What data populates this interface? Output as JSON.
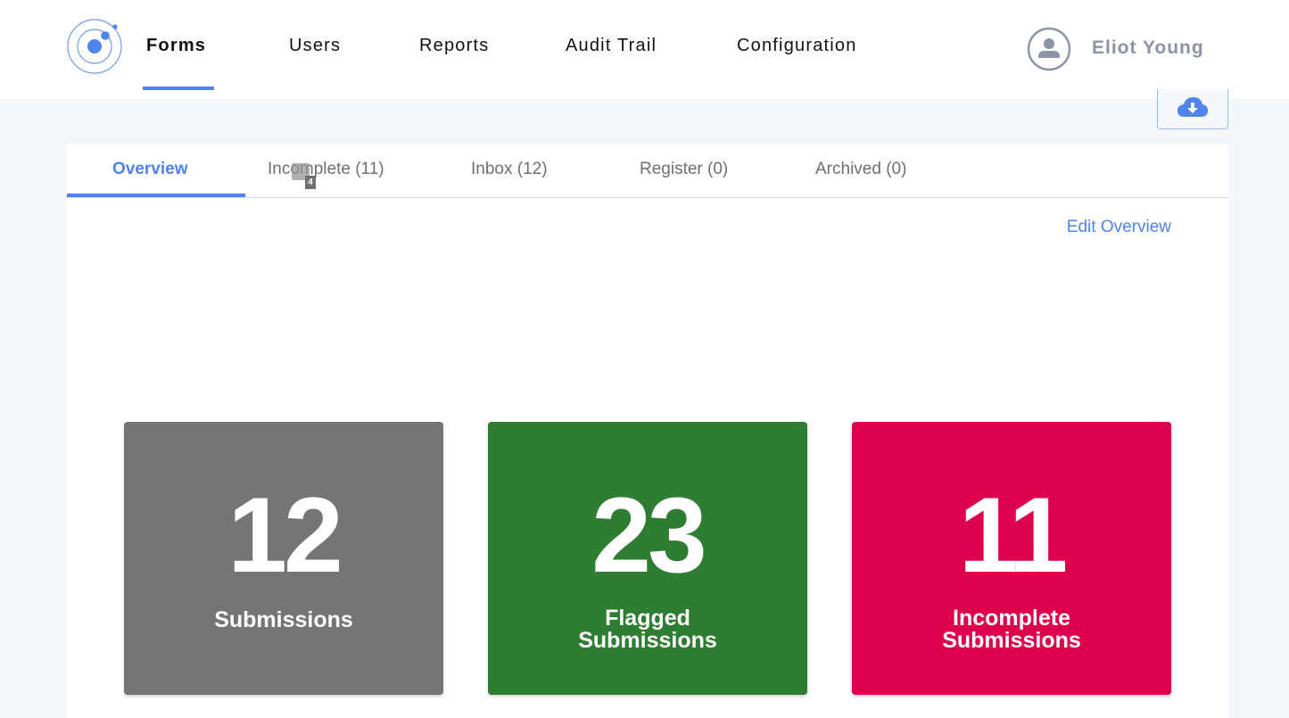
{
  "nav": {
    "items": [
      {
        "label": "Forms",
        "active": true
      },
      {
        "label": "Users",
        "active": false
      },
      {
        "label": "Reports",
        "active": false
      },
      {
        "label": "Audit Trail",
        "active": false
      },
      {
        "label": "Configuration",
        "active": false
      }
    ],
    "user": {
      "name": "Eliot Young",
      "icon": "user-circle-icon"
    },
    "logo_icon": "orbit-logo-icon"
  },
  "toolbar": {
    "download_icon": "cloud-download-icon"
  },
  "tabs": [
    {
      "label": "Overview",
      "active": true
    },
    {
      "label": "Incomplete (11)",
      "active": false
    },
    {
      "label": "Inbox (12)",
      "active": false
    },
    {
      "label": "Register (0)",
      "active": false
    },
    {
      "label": "Archived (0)",
      "active": false
    }
  ],
  "overlay_badge": {
    "value": "4"
  },
  "overview": {
    "edit_label": "Edit Overview",
    "cards": [
      {
        "value": "12",
        "label": "Submissions",
        "color": "#757575"
      },
      {
        "value": "23",
        "label": "Flagged Submissions",
        "color": "#2e7d32"
      },
      {
        "value": "11",
        "label": "Incomplete Submissions",
        "color": "#dd004d"
      }
    ]
  },
  "colors": {
    "accent": "#4f83ee",
    "page_bg": "#f5f7fb",
    "nav_text": "#111111",
    "tab_text": "#6f6f6f",
    "user_text": "#8b93a5"
  }
}
